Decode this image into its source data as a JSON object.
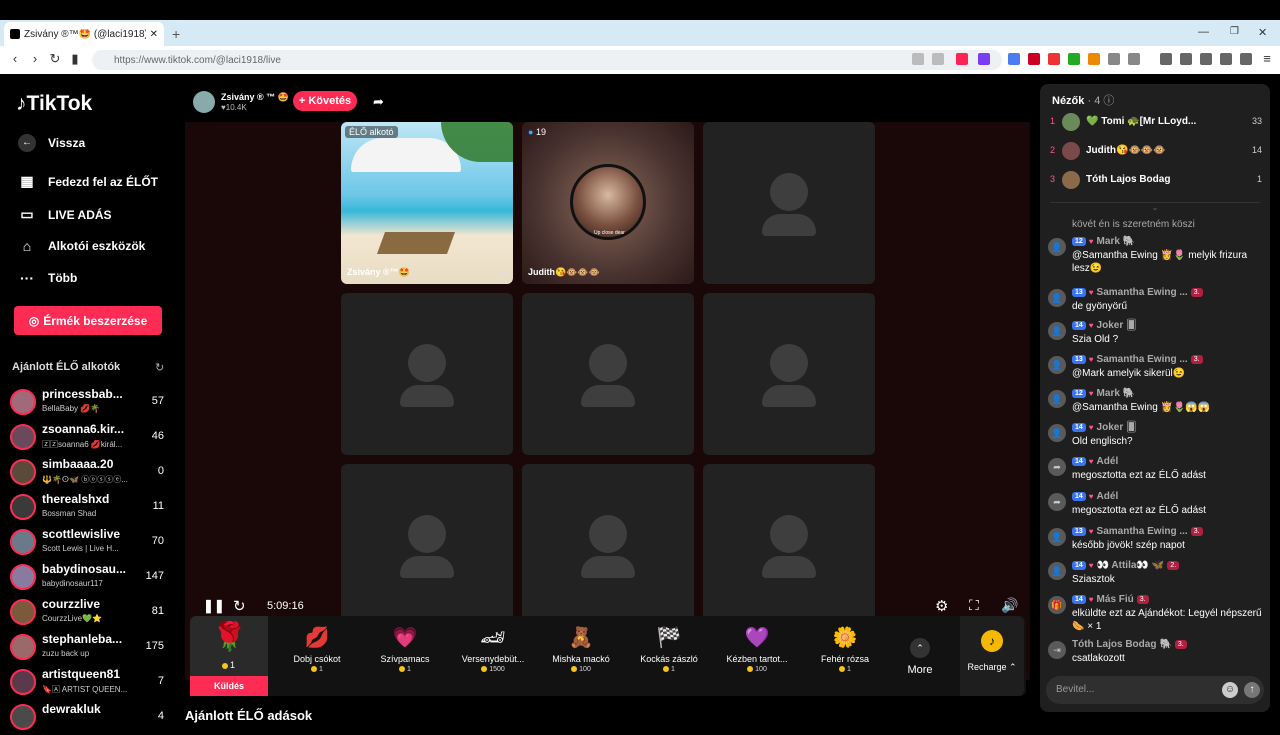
{
  "browser": {
    "tab_title": "Zsivány ®™🤩 (@laci1918) É...",
    "url": "https://www.tiktok.com/@laci1918/live"
  },
  "sidebar": {
    "logo": "TikTok",
    "back": "Vissza",
    "nav": [
      "Fedezd fel az ÉLŐT",
      "LIVE ADÁS",
      "Alkotói eszközök",
      "Több"
    ],
    "coin_button": "Érmék beszerzése",
    "recommended_heading": "Ajánlott ÉLŐ alkotók",
    "creators": [
      {
        "name": "princessbab...",
        "sub": "BellaBaby 💋🌴",
        "count": "57"
      },
      {
        "name": "zsoanna6.kir...",
        "sub": "🅉🅉soanna6 💋királ...",
        "count": "46"
      },
      {
        "name": "simbaaaa.20",
        "sub": "🔱🌴ⵙ🦋 ⓑⓞⓢⓢⓔ...",
        "count": "0"
      },
      {
        "name": "therealshxd",
        "sub": "Bossman Shad",
        "count": "11"
      },
      {
        "name": "scottlewislive",
        "sub": "Scott Lewis | Live H...",
        "count": "70"
      },
      {
        "name": "babydinosau...",
        "sub": "babydinosaur117",
        "count": "147"
      },
      {
        "name": "courzzlive",
        "sub": "CourzzLive💚⭐",
        "count": "81"
      },
      {
        "name": "stephanleba...",
        "sub": "zuzu back up",
        "count": "175"
      },
      {
        "name": "artistqueen81",
        "sub": "🔖🄰 ARTIST QUEEN...",
        "count": "7"
      },
      {
        "name": "dewrakluk",
        "sub": "",
        "count": "4"
      }
    ]
  },
  "host": {
    "name": "Zsivány ® ™ 🤩",
    "likes": "♥10.4K",
    "follow": "+ Követés"
  },
  "tiles": {
    "host_badge": "ÉLŐ alkotó",
    "host_label": "Zsivány ®™🤩",
    "guest_count": "19",
    "guest_label": "Judith😘🐵🐵🐵",
    "guest_caption": "Up close dear"
  },
  "controls": {
    "time": "5:09:16"
  },
  "gifts": {
    "selected": {
      "price": "1",
      "send": "Küldés"
    },
    "items": [
      {
        "name": "Dobj csókot",
        "price": "1",
        "icon": "💋"
      },
      {
        "name": "Szívpamacs",
        "price": "1",
        "icon": "💗"
      },
      {
        "name": "Versenydebüt...",
        "price": "1500",
        "icon": "🏎"
      },
      {
        "name": "Mishka mackó",
        "price": "100",
        "icon": "🧸"
      },
      {
        "name": "Kockás zászló",
        "price": "1",
        "icon": "🏁"
      },
      {
        "name": "Kézben tartot...",
        "price": "100",
        "icon": "💜"
      },
      {
        "name": "Fehér rózsa",
        "price": "1",
        "icon": "🌼"
      }
    ],
    "more": "More",
    "recharge": "Recharge"
  },
  "viewers": {
    "heading": "Nézők",
    "count": "· 4",
    "list": [
      {
        "rank": "1",
        "name": "💚 Tomi 🐢[Mr LLoyd...",
        "score": "33"
      },
      {
        "rank": "2",
        "name": "Judith😘🐵🐵🐵",
        "score": "14"
      },
      {
        "rank": "3",
        "name": "Tóth Lajos Bodag",
        "score": "1"
      }
    ]
  },
  "chat": {
    "partial": "kövét én is szeretném köszi",
    "messages": [
      {
        "level": "12",
        "user": "Mark",
        "extra": "🐘",
        "badge": "",
        "text": "@Samantha Ewing 👸🌷 melyik frizura lesz😉"
      },
      {
        "level": "13",
        "user": "Samantha Ewing ...",
        "extra": "",
        "badge": "3.",
        "text": "de gyönyörű"
      },
      {
        "level": "14",
        "user": "Joker",
        "extra": "🂠",
        "badge": "",
        "text": "Szia Old ?"
      },
      {
        "level": "13",
        "user": "Samantha Ewing ...",
        "extra": "",
        "badge": "3.",
        "text": "@Mark amelyik sikerül😉"
      },
      {
        "level": "12",
        "user": "Mark",
        "extra": "🐘",
        "badge": "",
        "text": "@Samantha Ewing 👸🌷😱😱"
      },
      {
        "level": "14",
        "user": "Joker",
        "extra": "🂠",
        "badge": "",
        "text": "Old englisch?"
      },
      {
        "level": "14",
        "user": "Adél",
        "extra": "",
        "badge": "",
        "text": "megosztotta ezt az ÉLŐ adást"
      },
      {
        "level": "14",
        "user": "Adél",
        "extra": "",
        "badge": "",
        "text": "megosztotta ezt az ÉLŐ adást"
      },
      {
        "level": "13",
        "user": "Samantha Ewing ...",
        "extra": "",
        "badge": "3.",
        "text": "később jövök! szép napot"
      },
      {
        "level": "14",
        "user": "👀 Attila👀",
        "extra": "🦋",
        "badge": "2.",
        "text": "Sziasztok"
      },
      {
        "level": "14",
        "user": "Más Fiú",
        "extra": "",
        "badge": "3.",
        "text": "elküldte ezt az Ajándékot: Legyél népszerű 🌭 × 1"
      },
      {
        "level": "",
        "user": "Tóth Lajos Bodag",
        "extra": "🐘",
        "badge": "3.",
        "text": "csatlakozott"
      }
    ],
    "input_placeholder": "Bevitel..."
  },
  "bottom_title": "Ajánlott ÉLŐ adások"
}
